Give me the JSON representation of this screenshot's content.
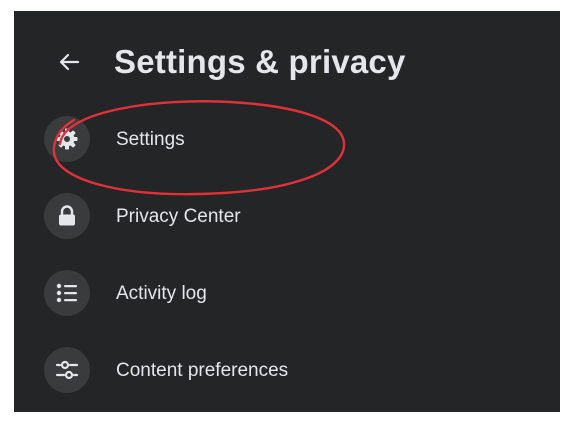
{
  "header": {
    "title": "Settings & privacy",
    "back_icon": "arrow-left-icon"
  },
  "menu": {
    "items": [
      {
        "label": "Settings",
        "icon": "gear-icon"
      },
      {
        "label": "Privacy Center",
        "icon": "lock-icon"
      },
      {
        "label": "Activity log",
        "icon": "list-icon"
      },
      {
        "label": "Content preferences",
        "icon": "sliders-icon"
      }
    ]
  },
  "colors": {
    "panel_background": "#242526",
    "icon_background": "#3a3b3c",
    "text": "#e4e6eb",
    "annotation": "#e0313b"
  }
}
